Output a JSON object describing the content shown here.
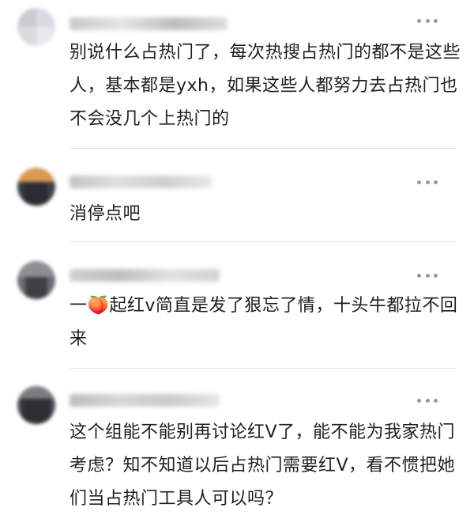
{
  "comments": [
    {
      "text": "别说什么占热门了，每次热搜占热门的都不是这些人，基本都是yxh，如果这些人都努力去占热门也不会没几个上热门的"
    },
    {
      "text": "消停点吧"
    },
    {
      "text": "一🍑起红v简直是发了狠忘了情，十头牛都拉不回来"
    },
    {
      "text": "这个组能不能别再讨论红V了，能不能为我家热门考虑？知不知道以后占热门需要红V，看不惯把她们当占热门工具人可以吗？"
    }
  ],
  "icons": {
    "more": "more-dots-icon",
    "avatar": "blurred-avatar"
  }
}
